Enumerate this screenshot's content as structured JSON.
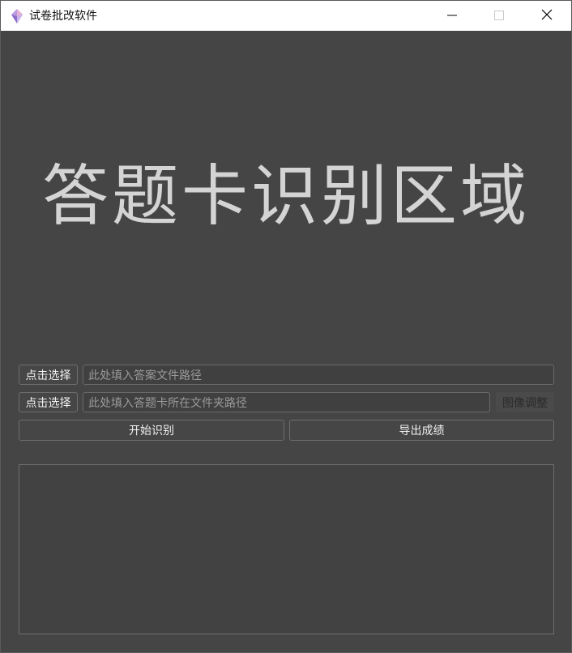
{
  "window": {
    "title": "试卷批改软件",
    "icons": [
      "app-icon",
      "minimize-icon",
      "maximize-icon",
      "close-icon"
    ]
  },
  "main": {
    "canvas_label": "答题卡识别区域"
  },
  "answer_row": {
    "select_label": "点击选择",
    "placeholder": "此处填入答案文件路径"
  },
  "cards_row": {
    "select_label": "点击选择",
    "placeholder": "此处填入答题卡所在文件夹路径",
    "adjust_label": "图像调整"
  },
  "actions": {
    "start_label": "开始识别",
    "export_label": "导出成绩"
  },
  "output": {
    "text": ""
  },
  "colors": {
    "background": "#454545",
    "text": "#d4d4d4",
    "border": "#6e6e6e"
  }
}
